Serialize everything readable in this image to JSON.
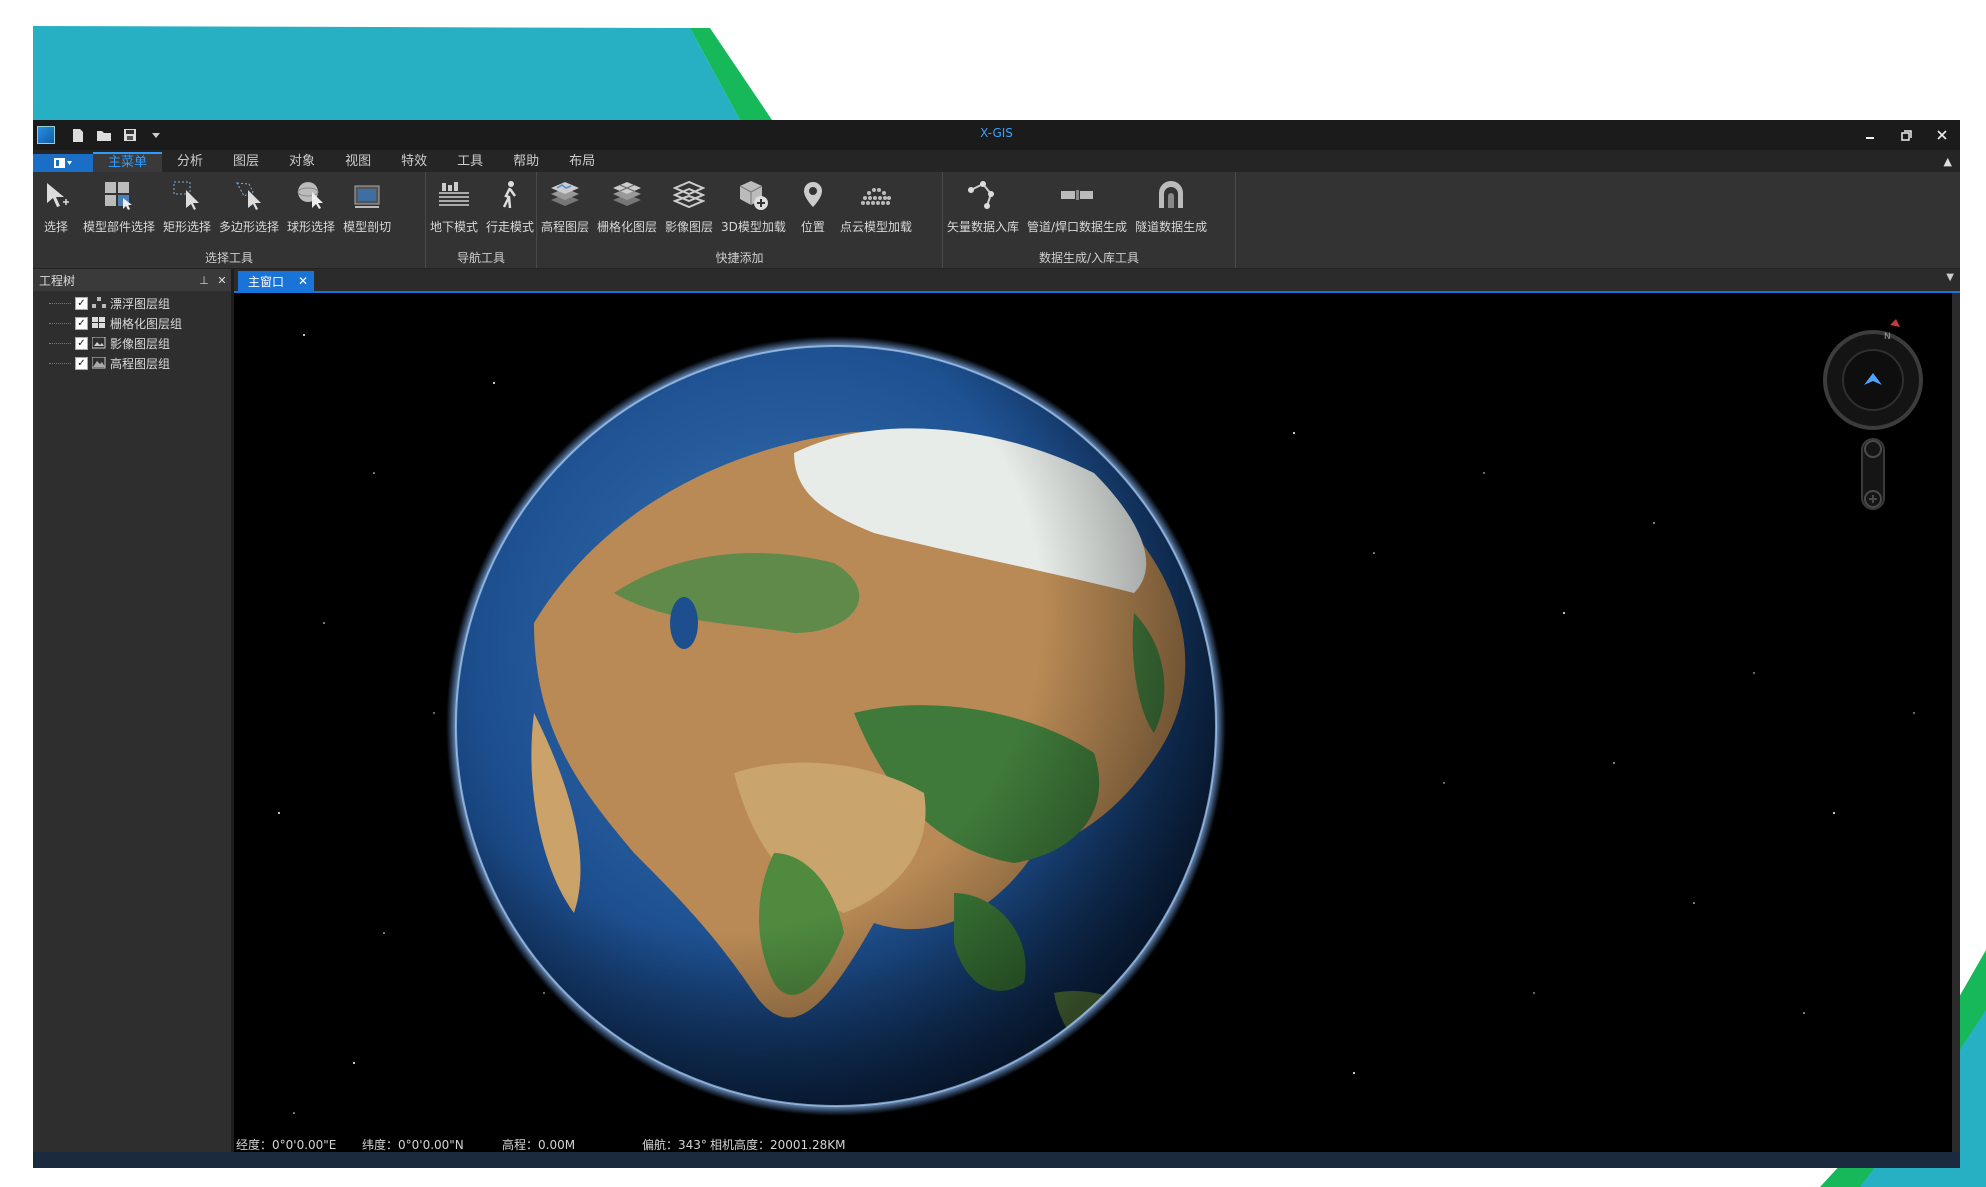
{
  "window": {
    "title": "X-GIS"
  },
  "menu": {
    "tabs": [
      "主菜单",
      "分析",
      "图层",
      "对象",
      "视图",
      "特效",
      "工具",
      "帮助",
      "布局"
    ],
    "active": "主菜单"
  },
  "ribbon": {
    "groups": [
      {
        "label": "选择工具",
        "buttons": [
          "选择",
          "模型部件选择",
          "矩形选择",
          "多边形选择",
          "球形选择",
          "模型剖切"
        ]
      },
      {
        "label": "导航工具",
        "buttons": [
          "地下模式",
          "行走模式"
        ]
      },
      {
        "label": "快捷添加",
        "buttons": [
          "高程图层",
          "栅格化图层",
          "影像图层",
          "3D模型加载",
          "位置",
          "点云模型加载"
        ]
      },
      {
        "label": "数据生成/入库工具",
        "buttons": [
          "矢量数据入库",
          "管道/焊口数据生成",
          "隧道数据生成"
        ]
      }
    ]
  },
  "panel": {
    "title": "工程树",
    "items": [
      "漂浮图层组",
      "栅格化图层组",
      "影像图层组",
      "高程图层组"
    ]
  },
  "doc_tab": {
    "label": "主窗口"
  },
  "compass": {
    "north": "N"
  },
  "status": {
    "longitude": "经度：0°0'0.00\"E",
    "latitude": "纬度：0°0'0.00\"N",
    "elevation": "高程：0.00M",
    "heading": "偏航：343°",
    "camera_height": "相机高度：20001.28KM"
  },
  "colors": {
    "accent": "#1a73d8",
    "deco_teal": "#27b0c4",
    "deco_green": "#17b85a"
  }
}
